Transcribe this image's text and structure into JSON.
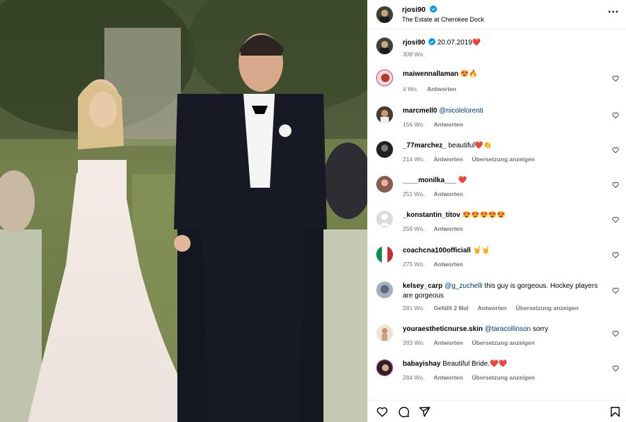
{
  "post": {
    "username": "rjosi90",
    "location": "The Estate at Cherokee Dock",
    "more_icon": "more-options-icon"
  },
  "caption": {
    "username": "rjosi90",
    "date": "20.07.2019",
    "emoji": "❤️",
    "time": "308 Wo."
  },
  "comments": [
    {
      "username": "maiwennallaman",
      "text": " 😍🔥",
      "mention": "",
      "time": "4 Wo.",
      "likes": "",
      "reply": "Antworten",
      "translate": ""
    },
    {
      "username": "marcmell0",
      "text": "",
      "mention": "@nicolelorenti",
      "time": "156 Wo.",
      "likes": "",
      "reply": "Antworten",
      "translate": ""
    },
    {
      "username": "_77marchez_",
      "text": " beautiful❤️👏",
      "mention": "",
      "time": "214 Wo.",
      "likes": "",
      "reply": "Antworten",
      "translate": "Übersetzung anzeigen"
    },
    {
      "username": "____monilka___",
      "text": " ❤️",
      "mention": "",
      "time": "251 Wo.",
      "likes": "",
      "reply": "Antworten",
      "translate": ""
    },
    {
      "username": "_konstantin_titov",
      "text": " 😍😍😍😍😍",
      "mention": "",
      "time": "256 Wo.",
      "likes": "",
      "reply": "Antworten",
      "translate": ""
    },
    {
      "username": "coachcna100officiall",
      "text": " 🤘🤘",
      "mention": "",
      "time": "275 Wo.",
      "likes": "",
      "reply": "Antworten",
      "translate": ""
    },
    {
      "username": "kelsey_carp",
      "text": " this guy is gorgeous. Hockey players are gorgeous",
      "mention": "@g_zuchelli",
      "time": "281 Wo.",
      "likes": "Gefällt 2 Mal",
      "reply": "Antworten",
      "translate": "Übersetzung anzeigen"
    },
    {
      "username": "youraestheticnurse.skin",
      "text": " sorry",
      "mention": "@taracollinson",
      "time": "283 Wo.",
      "likes": "",
      "reply": "Antworten",
      "translate": "Übersetzung anzeigen"
    },
    {
      "username": "babayishay",
      "text": " Beautiful Bride.❤️❤️",
      "mention": "",
      "time": "284 Wo.",
      "likes": "",
      "reply": "Antworten",
      "translate": "Übersetzung anzeigen"
    }
  ],
  "footer": {
    "icons": [
      "heart-icon",
      "comment-icon",
      "share-icon",
      "bookmark-icon"
    ]
  },
  "colors": {
    "accent_link": "#00376b",
    "verified": "#0095f6",
    "muted": "#737373"
  }
}
